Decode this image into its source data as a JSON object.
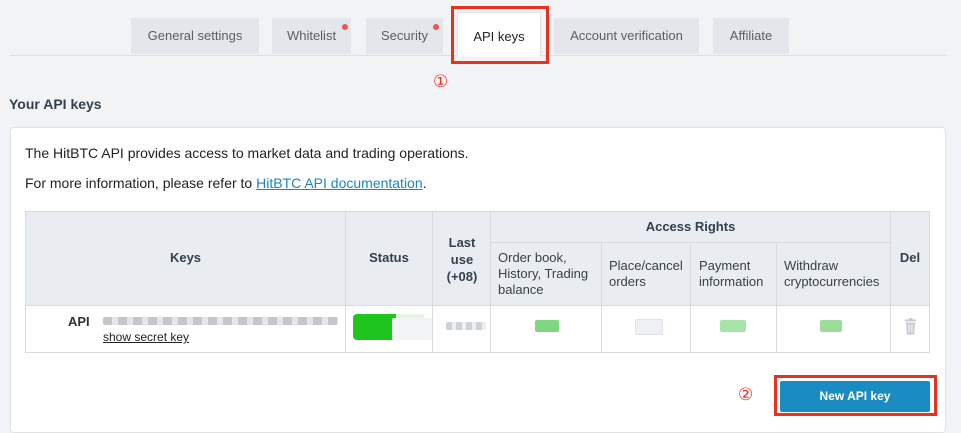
{
  "tabs": [
    {
      "label": "General settings",
      "active": false,
      "has_notification": false
    },
    {
      "label": "Whitelist",
      "active": false,
      "has_notification": true
    },
    {
      "label": "Security",
      "active": false,
      "has_notification": true
    },
    {
      "label": "API keys",
      "active": true,
      "has_notification": false
    },
    {
      "label": "Account verification",
      "active": false,
      "has_notification": false
    },
    {
      "label": "Affiliate",
      "active": false,
      "has_notification": false
    }
  ],
  "annotations": {
    "step1": "①",
    "step2": "②"
  },
  "section_title": "Your API keys",
  "intro": {
    "line1": "The HitBTC API provides access to market data and trading operations.",
    "line2_prefix": "For more information, please refer to ",
    "line2_link": "HitBTC API documentation",
    "line2_suffix": "."
  },
  "table": {
    "headers": {
      "keys": "Keys",
      "status": "Status",
      "last_use": "Last use (+08)",
      "access_rights": "Access Rights",
      "del": "Del"
    },
    "access_columns": [
      "Order book, History, Trading balance",
      "Place/cancel orders",
      "Payment information",
      "Withdraw cryptocurrencies"
    ],
    "rows": [
      {
        "label": "API",
        "show_secret": "show secret key"
      }
    ]
  },
  "new_key_button": "New API key",
  "colors": {
    "accent": "#1a8cc1",
    "highlight": "#e8311f",
    "status_on": "#1dc51d"
  }
}
